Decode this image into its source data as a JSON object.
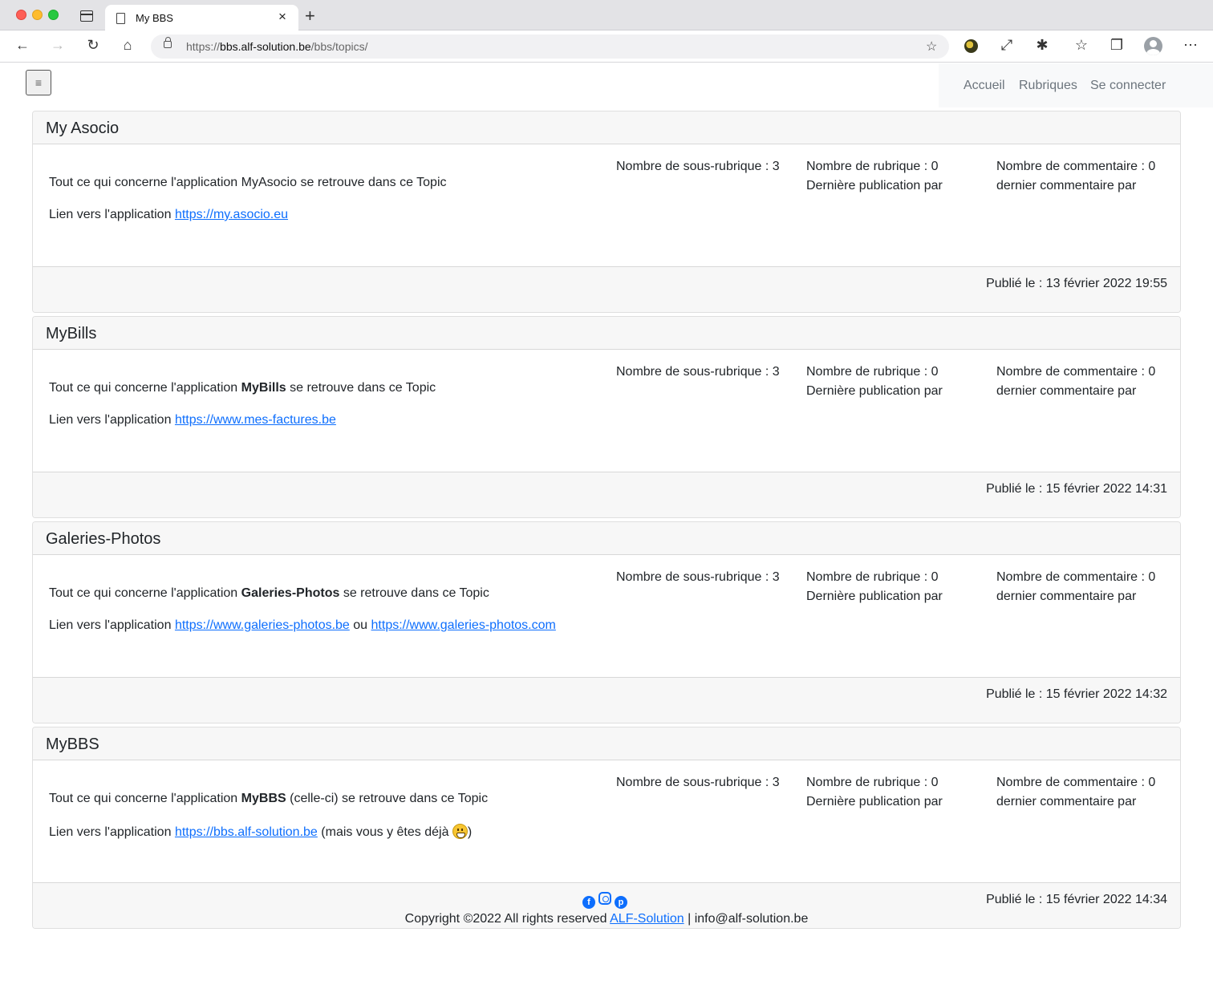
{
  "browser": {
    "tab_title": "My BBS",
    "url_scheme": "https://",
    "url_host": "bbs.alf-solution.be",
    "url_path": "/bbs/topics/"
  },
  "nav": {
    "toggle_icon": "≡",
    "links": [
      "Accueil",
      "Rubriques",
      "Se connecter"
    ]
  },
  "labels": {
    "desc_prefix": "Tout ce qui concerne l'application",
    "desc_suffix": "se retrouve dans ce Topic",
    "link_prefix": "Lien vers l'application",
    "published_prefix": "Publié le : "
  },
  "topics": [
    {
      "title": "My Asocio",
      "app_name": "MyAsocio",
      "app_name_bold": false,
      "desc_extra": "",
      "links": [
        "https://my.asocio.eu"
      ],
      "link_joiner": "",
      "link_suffix": "",
      "stats": {
        "sub_rubrics": "Nombre de sous-rubrique : 3",
        "rubrics": "Nombre de rubrique : 0",
        "last_pub": "Dernière publication par",
        "comments": "Nombre de commentaire : 0",
        "last_comment": "dernier commentaire par"
      },
      "published": "13 février 2022 19:55"
    },
    {
      "title": "MyBills",
      "app_name": "MyBills",
      "app_name_bold": true,
      "desc_extra": "",
      "links": [
        "https://www.mes-factures.be"
      ],
      "link_joiner": "",
      "link_suffix": "",
      "stats": {
        "sub_rubrics": "Nombre de sous-rubrique : 3",
        "rubrics": "Nombre de rubrique : 0",
        "last_pub": "Dernière publication par",
        "comments": "Nombre de commentaire : 0",
        "last_comment": "dernier commentaire par"
      },
      "published": "15 février 2022 14:31"
    },
    {
      "title": "Galeries-Photos",
      "app_name": "Galeries-Photos",
      "app_name_bold": true,
      "desc_extra": "",
      "links": [
        "https://www.galeries-photos.be",
        "https://www.galeries-photos.com"
      ],
      "link_joiner": "ou",
      "link_suffix": "",
      "stats": {
        "sub_rubrics": "Nombre de sous-rubrique : 3",
        "rubrics": "Nombre de rubrique : 0",
        "last_pub": "Dernière publication par",
        "comments": "Nombre de commentaire : 0",
        "last_comment": "dernier commentaire par"
      },
      "published": "15 février 2022 14:32"
    },
    {
      "title": "MyBBS",
      "app_name": "MyBBS",
      "app_name_bold": true,
      "desc_extra": "(celle-ci)",
      "links": [
        "https://bbs.alf-solution.be"
      ],
      "link_joiner": "",
      "link_suffix": "(mais vous y êtes déjà",
      "stats": {
        "sub_rubrics": "Nombre de sous-rubrique : 3",
        "rubrics": "Nombre de rubrique : 0",
        "last_pub": "Dernière publication par",
        "comments": "Nombre de commentaire : 0",
        "last_comment": "dernier commentaire par"
      },
      "published": "15 février 2022 14:34"
    }
  ],
  "footer": {
    "icons": [
      "facebook-icon",
      "instagram-icon",
      "pinterest-icon"
    ],
    "copyright": "Copyright ©2022 All rights reserved",
    "company_link": "ALF-Solution",
    "separator": "|",
    "email": "info@alf-solution.be"
  }
}
